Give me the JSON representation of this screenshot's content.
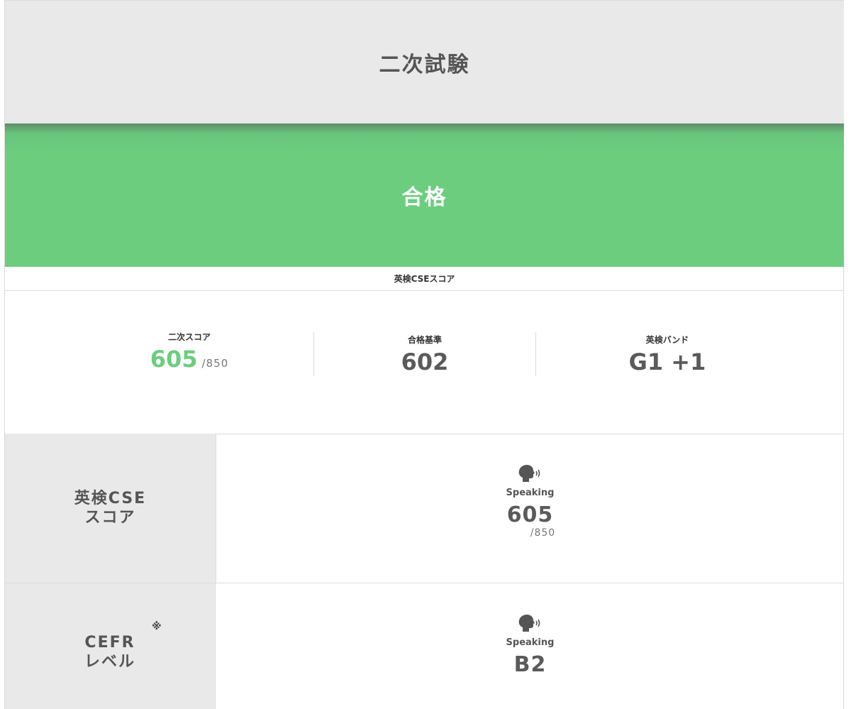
{
  "header": {
    "title": "二次試験"
  },
  "result": {
    "label": "合格"
  },
  "cse_caption": "英検CSEスコア",
  "summary": {
    "score": {
      "label": "二次スコア",
      "value": "605",
      "max": "/850"
    },
    "pass": {
      "label": "合格基準",
      "value": "602"
    },
    "band": {
      "label": "英検バンド",
      "value": "G1 +1"
    }
  },
  "rows": {
    "cse": {
      "head_line1": "英検CSE",
      "head_line2": "スコア",
      "skill_name": "Speaking",
      "skill_icon": "speaking-head-icon",
      "value": "605",
      "max": "/850"
    },
    "cefr": {
      "head_line1": "CEFR",
      "head_line2": "レベル",
      "note_mark": "※",
      "skill_name": "Speaking",
      "skill_icon": "speaking-head-icon",
      "value": "B2"
    }
  },
  "colors": {
    "pass_green": "#6ccd7f",
    "header_gray": "#e9e9e9",
    "text_gray": "#5a5a5a"
  }
}
